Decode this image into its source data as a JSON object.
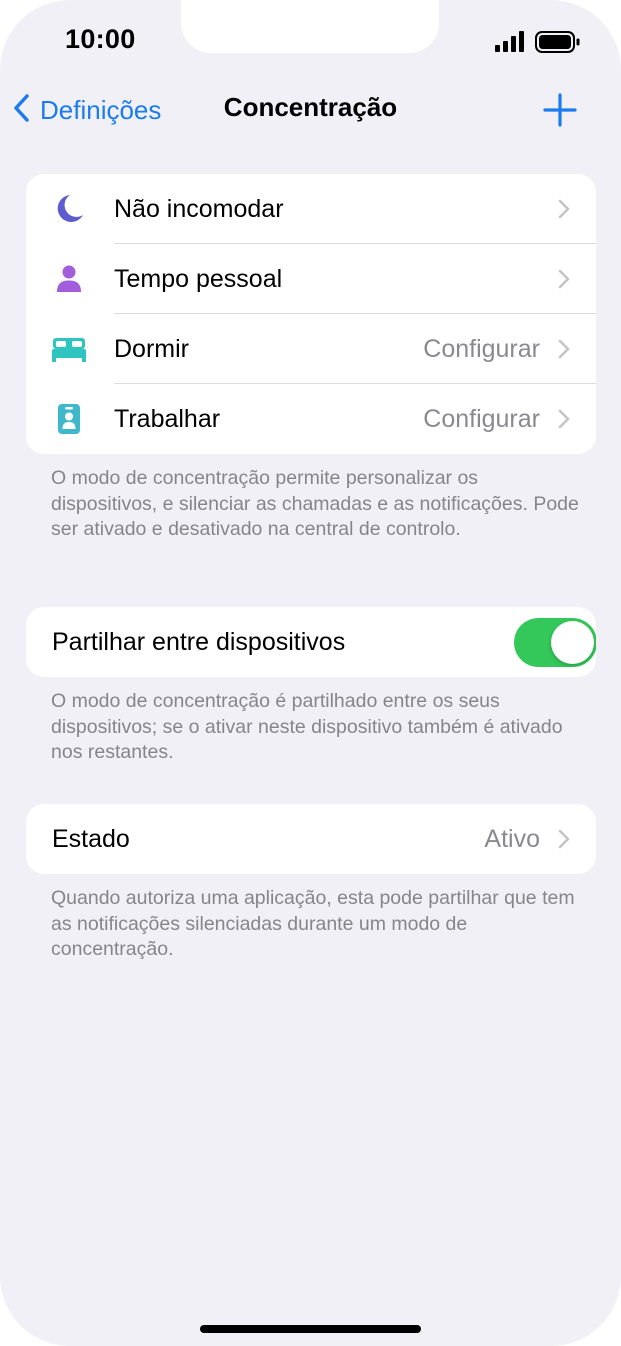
{
  "status_bar": {
    "time": "10:00",
    "signal_icon": "cellular-signal-icon",
    "battery_icon": "battery-full-icon"
  },
  "nav": {
    "back_label": "Definições",
    "title": "Concentração",
    "add_icon": "plus-icon",
    "accent_color": "#1a7cf0"
  },
  "focus_modes": [
    {
      "label": "Não incomodar",
      "value": "",
      "icon": "moon-icon",
      "icon_color": "#5d5ccf"
    },
    {
      "label": "Tempo pessoal",
      "value": "",
      "icon": "person-icon",
      "icon_color": "#a25ddb"
    },
    {
      "label": "Dormir",
      "value": "Configurar",
      "icon": "bed-icon",
      "icon_color": "#2ec4c0"
    },
    {
      "label": "Trabalhar",
      "value": "Configurar",
      "icon": "id-badge-icon",
      "icon_color": "#3fb8c9"
    }
  ],
  "focus_footer": "O modo de concentração permite personalizar os dispositivos, e silenciar as chamadas e as notificações. Pode ser ativado e desativado na central de controlo.",
  "share": {
    "label": "Partilhar entre dispositivos",
    "enabled": true,
    "toggle_color": "#34c759",
    "footer": "O modo de concentração é partilhado entre os seus dispositivos; se o ativar neste dispositivo também é ativado nos restantes."
  },
  "status_row": {
    "label": "Estado",
    "value": "Ativo",
    "footer": "Quando autoriza uma aplicação, esta pode partilhar que tem as notificações silenciadas durante um modo de concentração."
  }
}
